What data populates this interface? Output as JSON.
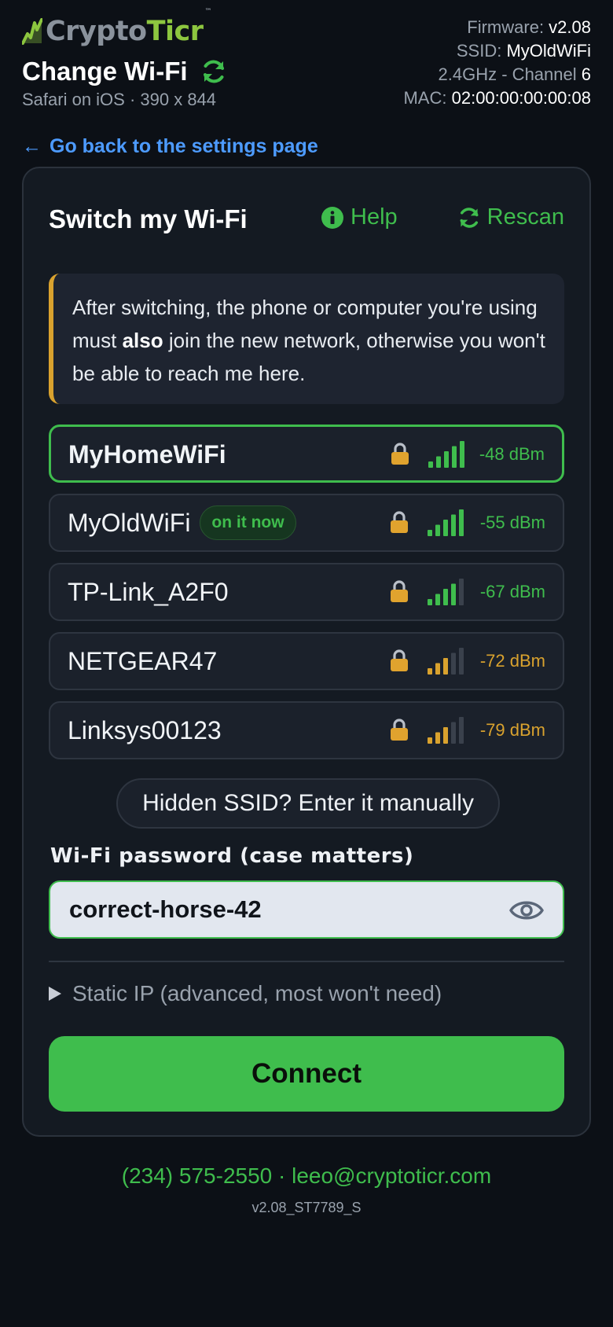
{
  "brand": {
    "name_part1": "Crypto",
    "name_part2": "Ticr",
    "tm": "™"
  },
  "header": {
    "title": "Change Wi-Fi",
    "subtitle": "Safari on iOS · 390 x 844",
    "device_info": {
      "firmware_label": "Firmware: ",
      "firmware_value": "v2.08",
      "ssid_label": "SSID: ",
      "ssid_value": "MyOldWiFi",
      "band_label": "2.4GHz - Channel ",
      "band_value": "6",
      "mac_label": "MAC: ",
      "mac_value": "02:00:00:00:00:08"
    }
  },
  "back_link": {
    "arrow": "←",
    "label": "Go back to the settings page"
  },
  "card": {
    "title": "Switch my Wi-Fi",
    "help_label": "Help",
    "rescan_label": "Rescan",
    "note": {
      "part1": "After switching, the phone or computer you're using must ",
      "bold": "also",
      "part2": " join the new network, otherwise you won't be able to reach me here."
    },
    "networks": [
      {
        "name": "MyHomeWiFi",
        "badge": "",
        "dbm": "-48 dBm",
        "bars_filled": 5,
        "strength_color": "#3fbd4d",
        "selected": true
      },
      {
        "name": "MyOldWiFi",
        "badge": "on it now",
        "dbm": "-55 dBm",
        "bars_filled": 5,
        "strength_color": "#3fbd4d",
        "selected": false
      },
      {
        "name": "TP-Link_A2F0",
        "badge": "",
        "dbm": "-67 dBm",
        "bars_filled": 4,
        "strength_color": "#3fbd4d",
        "selected": false
      },
      {
        "name": "NETGEAR47",
        "badge": "",
        "dbm": "-72 dBm",
        "bars_filled": 3,
        "strength_color": "#d9a22e",
        "selected": false
      },
      {
        "name": "Linksys00123",
        "badge": "",
        "dbm": "-79 dBm",
        "bars_filled": 3,
        "strength_color": "#d9a22e",
        "selected": false
      }
    ],
    "hidden_ssid_label": "Hidden SSID? Enter it manually",
    "password_label": "Wi-Fi password (case matters)",
    "password_value": "correct-horse-42",
    "static_ip_label": "Static IP (advanced, most won't need)",
    "connect_label": "Connect"
  },
  "footer": {
    "phone": "(234) 575-2550",
    "separator": " · ",
    "email": "leeo@cryptoticr.com",
    "version": "v2.08_ST7789_S"
  },
  "colors": {
    "accent_green": "#3fbd4d",
    "warning_amber": "#d9a22e",
    "link_blue": "#4d9bff",
    "background": "#0c1016"
  }
}
